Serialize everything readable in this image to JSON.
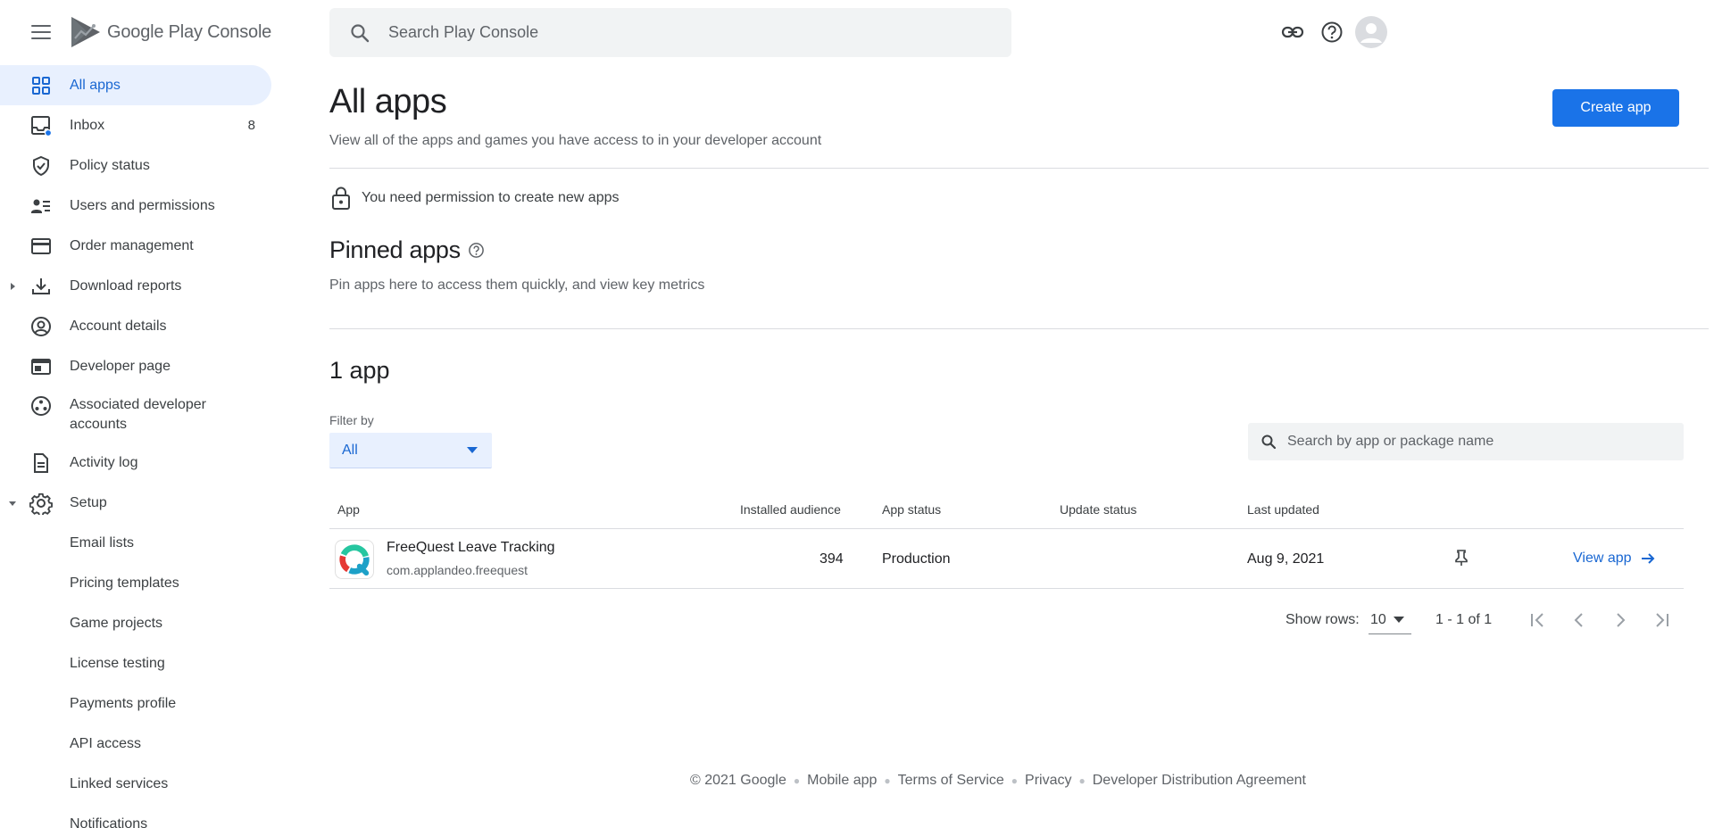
{
  "header": {
    "logo_google": "Google Play",
    "logo_console": "Console",
    "search_placeholder": "Search Play Console"
  },
  "sidebar": {
    "items": [
      {
        "label": "All apps",
        "icon": "grid-icon",
        "active": true
      },
      {
        "label": "Inbox",
        "icon": "inbox-icon",
        "badge": "8"
      },
      {
        "label": "Policy status",
        "icon": "shield-icon"
      },
      {
        "label": "Users and permissions",
        "icon": "users-icon"
      },
      {
        "label": "Order management",
        "icon": "credit-card-icon"
      },
      {
        "label": "Download reports",
        "icon": "download-icon"
      },
      {
        "label": "Account details",
        "icon": "account-circle-icon"
      },
      {
        "label": "Developer page",
        "icon": "web-page-icon"
      },
      {
        "label": "Associated developer accounts",
        "icon": "linked-accounts-icon"
      },
      {
        "label": "Activity log",
        "icon": "document-icon"
      },
      {
        "label": "Setup",
        "icon": "gear-icon"
      },
      {
        "label": "Email lists"
      },
      {
        "label": "Pricing templates"
      },
      {
        "label": "Game projects"
      },
      {
        "label": "License testing"
      },
      {
        "label": "Payments profile"
      },
      {
        "label": "API access"
      },
      {
        "label": "Linked services"
      },
      {
        "label": "Notifications"
      }
    ]
  },
  "main": {
    "title": "All apps",
    "subtitle": "View all of the apps and games you have access to in your developer account",
    "create_button": "Create app",
    "permission_notice": "You need permission to create new apps",
    "pinned_title": "Pinned apps",
    "pinned_subtitle": "Pin apps here to access them quickly, and view key metrics",
    "count_title": "1 app",
    "filter_label": "Filter by",
    "filter_value": "All",
    "table_search_placeholder": "Search by app or package name",
    "table": {
      "headers": [
        "App",
        "Installed audience",
        "App status",
        "Update status",
        "Last updated"
      ],
      "rows": [
        {
          "name": "FreeQuest Leave Tracking",
          "package": "com.applandeo.freequest",
          "installed_audience": "394",
          "app_status": "Production",
          "update_status": "",
          "last_updated": "Aug 9, 2021",
          "action": "View app"
        }
      ]
    },
    "pagination": {
      "rows_label": "Show rows:",
      "rows_value": "10",
      "range": "1 - 1 of 1"
    }
  },
  "footer": {
    "links": [
      "© 2021 Google",
      "Mobile app",
      "Terms of Service",
      "Privacy",
      "Developer Distribution Agreement"
    ]
  },
  "colors": {
    "accent": "#1a73e8",
    "active_bg": "#e8f0fe",
    "active_text": "#1967d2",
    "badge_dot": "#1a73e8"
  }
}
